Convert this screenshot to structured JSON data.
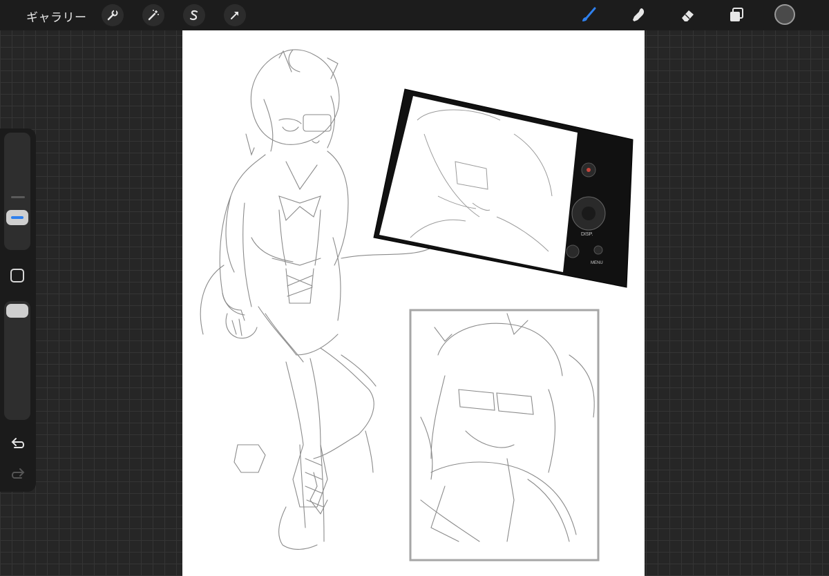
{
  "topbar": {
    "gallery_label": "ギャラリー",
    "left_tools": [
      {
        "name": "actions",
        "icon": "wrench-icon"
      },
      {
        "name": "adjustments",
        "icon": "magic-wand-icon"
      },
      {
        "name": "selection",
        "icon": "selection-s-icon"
      },
      {
        "name": "transform",
        "icon": "arrow-cursor-icon"
      }
    ],
    "right_tools": [
      {
        "name": "brush",
        "icon": "brush-icon",
        "active": true
      },
      {
        "name": "smudge",
        "icon": "smudge-finger-icon"
      },
      {
        "name": "eraser",
        "icon": "eraser-icon"
      },
      {
        "name": "layers",
        "icon": "layers-icon"
      },
      {
        "name": "color",
        "icon": "color-swatch",
        "value": "#4a4a4a"
      }
    ],
    "accent_color": "#2f80ed"
  },
  "sidebar": {
    "brush_size_slider": {
      "label": "brush-size"
    },
    "modify_button": {
      "icon": "square-icon"
    },
    "opacity_slider": {
      "label": "opacity"
    },
    "undo": {
      "icon": "undo-arrow-icon"
    },
    "redo": {
      "icon": "redo-arrow-icon",
      "enabled": false
    }
  },
  "camera": {
    "labels": {
      "disp": "DISP.",
      "menu": "MENU"
    }
  }
}
